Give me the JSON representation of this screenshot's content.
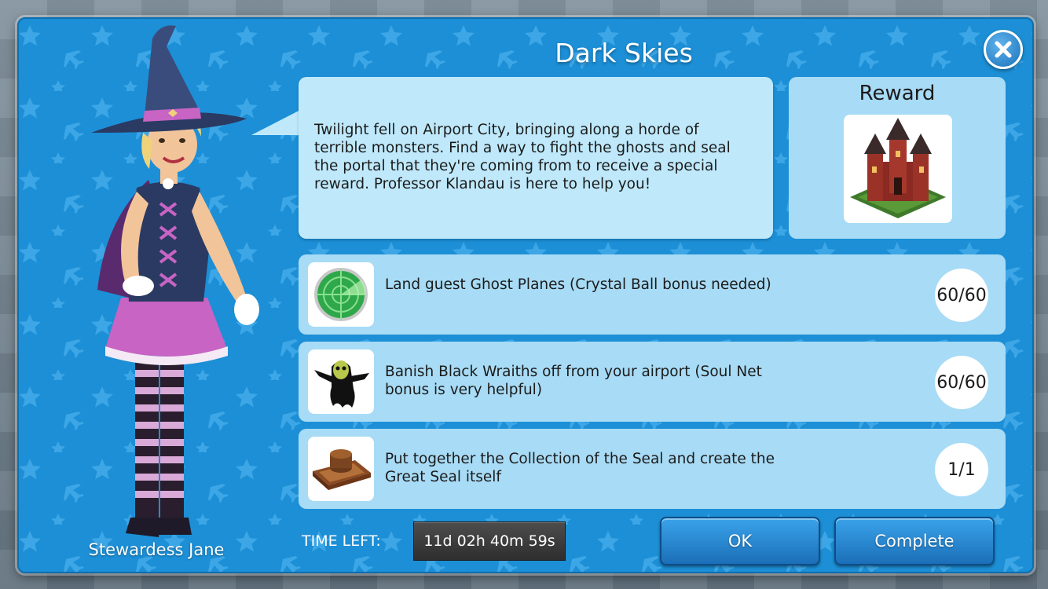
{
  "dialog": {
    "title": "Dark Skies",
    "close_icon": "close-x-icon"
  },
  "character": {
    "name": "Stewardess Jane"
  },
  "story": {
    "text": "Twilight fell on Airport City, bringing along a horde of terrible monsters. Find a way to fight the ghosts and seal the portal that they're coming from to receive a special reward. Professor Klandau is here to help you!"
  },
  "reward": {
    "title": "Reward",
    "icon": "haunted-castle-icon"
  },
  "tasks": [
    {
      "text": "Land guest Ghost Planes (Crystal Ball bonus needed)",
      "progress": "60/60",
      "icon": "radar-icon"
    },
    {
      "text": "Banish Black Wraiths off from your airport (Soul Net bonus is very helpful)",
      "progress": "60/60",
      "icon": "black-wraith-icon"
    },
    {
      "text": "Put together the Collection of the Seal and create the Great Seal itself",
      "progress": "1/1",
      "icon": "great-seal-icon"
    }
  ],
  "footer": {
    "time_left_label": "TIME LEFT:",
    "timer": "11d 02h 40m 59s",
    "ok_label": "OK",
    "complete_label": "Complete"
  },
  "colors": {
    "dialog_blue": "#1c8fd6",
    "panel_light": "#a8dbf5",
    "bubble": "#bfe9fb",
    "button_blue": "#2a88d0"
  }
}
